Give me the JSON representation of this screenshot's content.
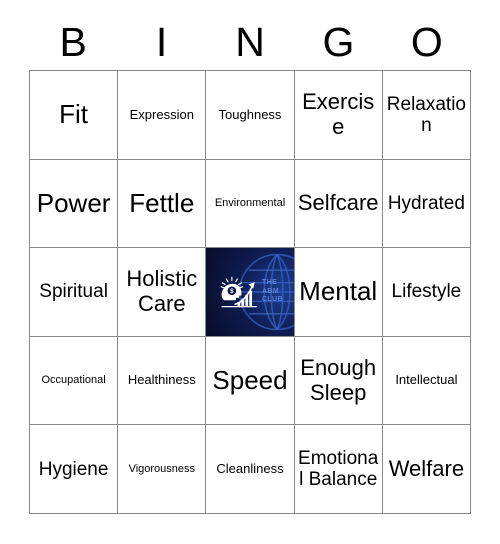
{
  "card": {
    "title": "BINGO",
    "header_letters": [
      "B",
      "I",
      "N",
      "G",
      "O"
    ],
    "columns": 5,
    "rows": 5,
    "colors": {
      "grid_line": "#8a8a8a",
      "cell_background": "#ffffff",
      "text": "#000000",
      "logo_background": "#0a1033",
      "logo_accent": "#1b3f8f",
      "logo_text": "#5b7fd4",
      "logo_mark": "#ffffff"
    }
  },
  "free_space": {
    "type": "logo",
    "brand_lines": [
      "THE",
      "ABM",
      "CLUB"
    ],
    "icon_names": [
      "head-dollar-idea-icon",
      "growth-bar-chart-arrow-icon",
      "globe-grid-icon"
    ]
  },
  "grid": [
    [
      {
        "label": "Fit",
        "size": "xl"
      },
      {
        "label": "Expression",
        "size": "sm"
      },
      {
        "label": "Toughness",
        "size": "sm"
      },
      {
        "label": "Exercise",
        "size": "lg"
      },
      {
        "label": "Relaxation",
        "size": "md"
      }
    ],
    [
      {
        "label": "Power",
        "size": "xl"
      },
      {
        "label": "Fettle",
        "size": "xl"
      },
      {
        "label": "Environmental",
        "size": "xs"
      },
      {
        "label": "Selfcare",
        "size": "lg"
      },
      {
        "label": "Hydrated",
        "size": "md"
      }
    ],
    [
      {
        "label": "Spiritual",
        "size": "md"
      },
      {
        "label": "Holistic Care",
        "size": "lg"
      },
      {
        "label": "",
        "size": "free"
      },
      {
        "label": "Mental",
        "size": "xl"
      },
      {
        "label": "Lifestyle",
        "size": "md"
      }
    ],
    [
      {
        "label": "Occupational",
        "size": "xs"
      },
      {
        "label": "Healthiness",
        "size": "sm"
      },
      {
        "label": "Speed",
        "size": "xl"
      },
      {
        "label": "Enough Sleep",
        "size": "lg"
      },
      {
        "label": "Intellectual",
        "size": "sm"
      }
    ],
    [
      {
        "label": "Hygiene",
        "size": "md"
      },
      {
        "label": "Vigorousness",
        "size": "xs"
      },
      {
        "label": "Cleanliness",
        "size": "sm"
      },
      {
        "label": "Emotional Balance",
        "size": "md"
      },
      {
        "label": "Welfare",
        "size": "lg"
      }
    ]
  ]
}
